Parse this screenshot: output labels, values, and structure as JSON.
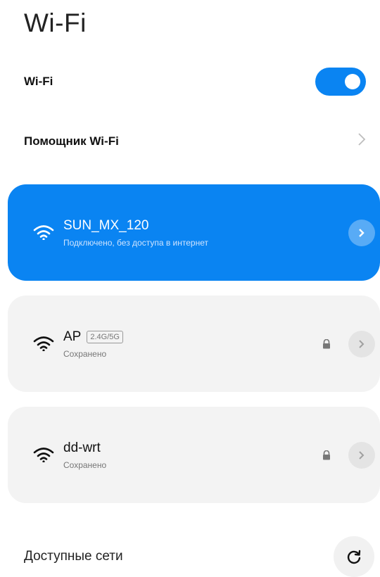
{
  "header": {
    "title": "Wi-Fi"
  },
  "wifi_toggle": {
    "label": "Wi-Fi",
    "enabled": true,
    "accent": "#0a84f2"
  },
  "assistant": {
    "label": "Помощник Wi-Fi",
    "icon": "chevron-right-icon"
  },
  "networks": [
    {
      "name": "SUN_MX_120",
      "status": "Подключено, без доступа в интернет",
      "band": "",
      "connected": true,
      "secured": false,
      "icon": "wifi-icon"
    },
    {
      "name": "AP",
      "status": "Сохранено",
      "band": "2.4G/5G",
      "connected": false,
      "secured": true,
      "icon": "wifi-icon"
    },
    {
      "name": "dd-wrt",
      "status": "Сохранено",
      "band": "",
      "connected": false,
      "secured": true,
      "icon": "wifi-icon"
    }
  ],
  "available": {
    "label": "Доступные сети",
    "icon": "refresh-icon"
  }
}
